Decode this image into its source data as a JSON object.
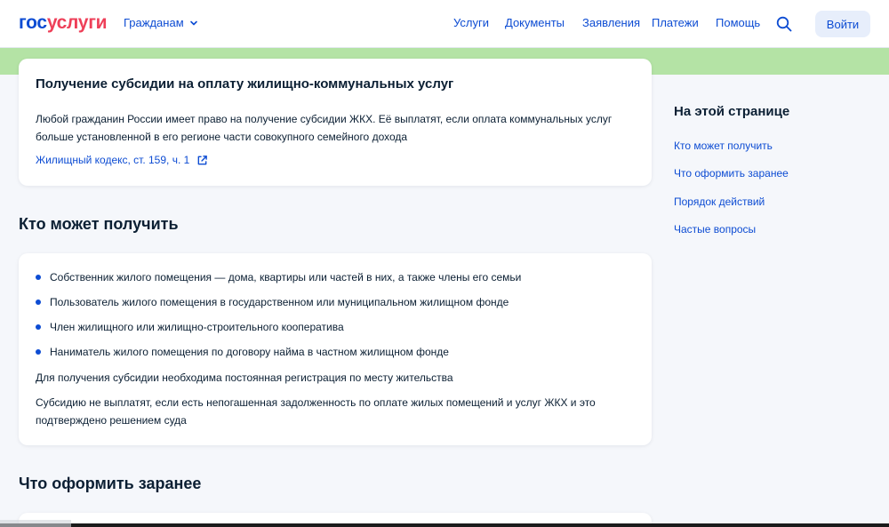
{
  "header": {
    "logo_part1": "гос",
    "logo_part2": "услуги",
    "citizens_label": "Гражданам",
    "nav": [
      "Услуги",
      "Документы",
      "Заявления",
      "Платежи",
      "Помощь"
    ],
    "login_label": "Войти"
  },
  "intro": {
    "title": "Получение субсидии на оплату жилищно-коммунальных услуг",
    "text": "Любой гражданин России имеет право на получение субсидии ЖКХ. Её выплатят, если оплата коммунальных услуг больше установленной в его регионе части совокупного семейного дохода",
    "law_link": "Жилищный кодекс, ст. 159, ч. 1"
  },
  "who": {
    "title": "Кто может получить",
    "bullets": [
      "Собственник жилого помещения — дома, квартиры или частей в них, а также члены его семьи",
      "Пользователь жилого помещения в государственном или муниципальном жилищном фонде",
      "Член жилищного или жилищно-строительного кооператива",
      "Наниматель жилого помещения по договору найма в частном жилищном фонде"
    ],
    "note_registration": "Для получения субсидии необходима постоянная регистрация по месту жительства",
    "note_debt": "Субсидию не выплатят, если есть непогашенная задолженность по оплате жилых помещений и услуг ЖКХ и это подтверждено решением суда"
  },
  "prepare": {
    "title": "Что оформить заранее"
  },
  "aside": {
    "title": "На этой странице",
    "links": [
      "Кто может получить",
      "Что оформить заранее",
      "Порядок действий",
      "Частые вопросы"
    ]
  },
  "colors": {
    "brand_blue": "#0d4cd3",
    "brand_red": "#ee3f58",
    "green_band": "#b4e3a5",
    "background": "#f5f7fb"
  }
}
